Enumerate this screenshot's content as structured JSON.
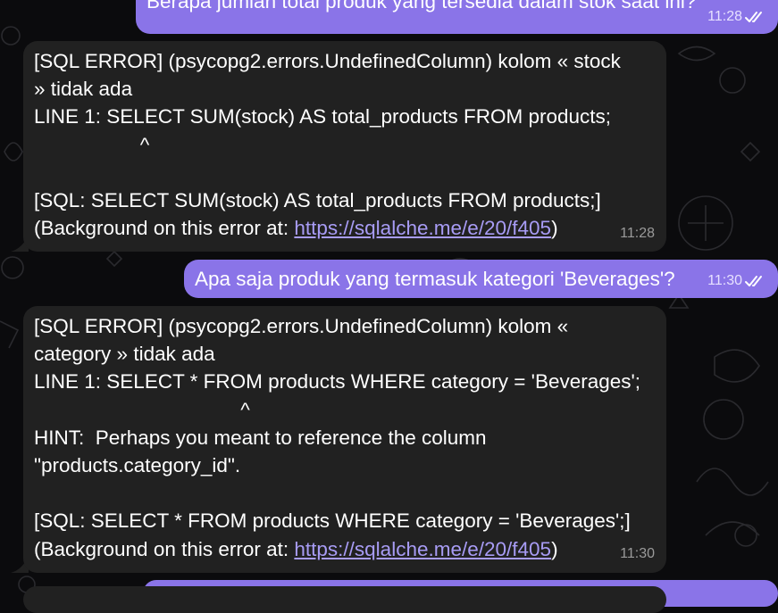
{
  "chat": {
    "outgoing_top": {
      "text": "Berapa jumlah total produk yang tersedia dalam stok saat ini?",
      "time": "11:28"
    },
    "error1": {
      "lines": [
        "[SQL ERROR] (psycopg2.errors.UndefinedColumn) kolom « stock",
        "» tidak ada",
        "LINE 1: SELECT SUM(stock) AS total_products FROM products;",
        "                   ^",
        "",
        "[SQL: SELECT SUM(stock) AS total_products FROM products;]"
      ],
      "last_prefix": "(Background on this error at: ",
      "link": "https://sqlalche.me/e/20/f405",
      "last_suffix": ")",
      "time": "11:28"
    },
    "outgoing_mid": {
      "text": "Apa saja produk yang termasuk kategori 'Beverages'?",
      "time": "11:30"
    },
    "error2": {
      "lines": [
        "[SQL ERROR] (psycopg2.errors.UndefinedColumn) kolom «",
        "category » tidak ada",
        "LINE 1: SELECT * FROM products WHERE category = 'Beverages';",
        "                                     ^",
        "HINT:  Perhaps you meant to reference the column",
        "\"products.category_id\".",
        "",
        "[SQL: SELECT * FROM products WHERE category = 'Beverages';]"
      ],
      "last_prefix": "(Background on this error at: ",
      "link": "https://sqlalche.me/e/20/f405",
      "last_suffix": ")",
      "time": "11:30"
    }
  },
  "colors": {
    "background": "#0b0b0d",
    "incoming_bubble": "#212121",
    "outgoing_bubble": "#8a74e8",
    "link": "#a89cf5"
  },
  "icons": {
    "read_status": "double-check-icon"
  }
}
